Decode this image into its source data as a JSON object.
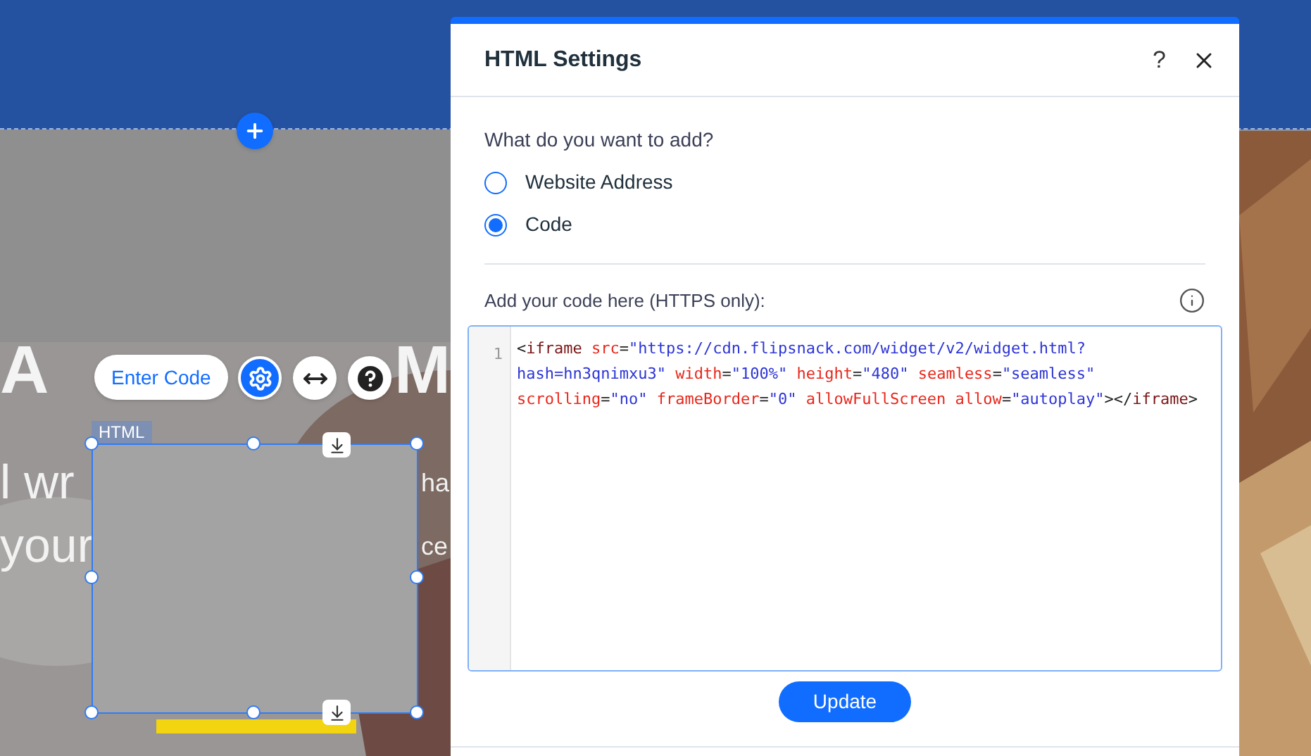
{
  "canvas": {
    "hero_title_parts": [
      "A",
      "M"
    ],
    "hero_lines": [
      {
        "left": "l wr",
        "right": "ha"
      },
      {
        "left": "your",
        "right": "ce"
      }
    ],
    "element_label": "HTML",
    "toolbar": {
      "enter_code": "Enter Code"
    }
  },
  "dialog": {
    "title": "HTML Settings",
    "help": "?",
    "question": "What do you want to add?",
    "options": [
      {
        "label": "Website Address",
        "selected": false
      },
      {
        "label": "Code",
        "selected": true
      }
    ],
    "code_label": "Add your code here (HTTPS only):",
    "code": {
      "line_number": "1",
      "rows": [
        {
          "segments": [
            {
              "kind": "punct",
              "text": "<"
            },
            {
              "kind": "tag",
              "text": "iframe"
            },
            {
              "kind": "attr",
              "text": " src"
            },
            {
              "kind": "punct",
              "text": "="
            },
            {
              "kind": "value",
              "text": "\"https://cdn.flipsnack.com/widget/v2/widget.html?"
            }
          ]
        },
        {
          "segments": [
            {
              "kind": "value",
              "text": "hash=hn3qnimxu3\""
            },
            {
              "kind": "attr",
              "text": " width"
            },
            {
              "kind": "punct",
              "text": "="
            },
            {
              "kind": "value",
              "text": "\"100%\""
            },
            {
              "kind": "attr",
              "text": " height"
            },
            {
              "kind": "punct",
              "text": "="
            },
            {
              "kind": "value",
              "text": "\"480\""
            },
            {
              "kind": "attr",
              "text": " seamless"
            },
            {
              "kind": "punct",
              "text": "="
            },
            {
              "kind": "value",
              "text": "\"seamless\""
            }
          ]
        },
        {
          "segments": [
            {
              "kind": "attr",
              "text": "scrolling"
            },
            {
              "kind": "punct",
              "text": "="
            },
            {
              "kind": "value",
              "text": "\"no\""
            },
            {
              "kind": "attr",
              "text": " frameBorder"
            },
            {
              "kind": "punct",
              "text": "="
            },
            {
              "kind": "value",
              "text": "\"0\""
            },
            {
              "kind": "attr",
              "text": " allowFullScreen"
            },
            {
              "kind": "attr",
              "text": " allow"
            },
            {
              "kind": "punct",
              "text": "="
            },
            {
              "kind": "value",
              "text": "\"autoplay\""
            },
            {
              "kind": "punct",
              "text": "></"
            },
            {
              "kind": "tag",
              "text": "iframe"
            },
            {
              "kind": "punct",
              "text": ">"
            }
          ]
        }
      ]
    },
    "update_button": "Update"
  }
}
